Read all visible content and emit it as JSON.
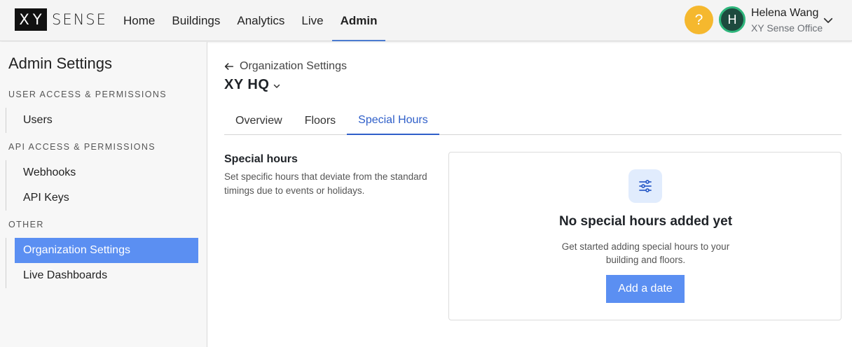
{
  "brand": {
    "mark": "XY",
    "word": "SENSE"
  },
  "nav": {
    "items": [
      {
        "label": "Home"
      },
      {
        "label": "Buildings"
      },
      {
        "label": "Analytics"
      },
      {
        "label": "Live"
      },
      {
        "label": "Admin"
      }
    ],
    "active": "Admin"
  },
  "header": {
    "help_label": "?",
    "avatar_initial": "H",
    "user_name": "Helena Wang",
    "user_org": "XY Sense Office"
  },
  "sidebar": {
    "title": "Admin Settings",
    "sections": [
      {
        "label": "USER ACCESS & PERMISSIONS",
        "items": [
          {
            "label": "Users"
          }
        ]
      },
      {
        "label": "API ACCESS & PERMISSIONS",
        "items": [
          {
            "label": "Webhooks"
          },
          {
            "label": "API Keys"
          }
        ]
      },
      {
        "label": "OTHER",
        "items": [
          {
            "label": "Organization Settings"
          },
          {
            "label": "Live Dashboards"
          }
        ]
      }
    ],
    "active_item": "Organization Settings"
  },
  "main": {
    "breadcrumb": "Organization Settings",
    "site_title": "XY HQ",
    "tabs": [
      {
        "label": "Overview"
      },
      {
        "label": "Floors"
      },
      {
        "label": "Special Hours"
      }
    ],
    "active_tab": "Special Hours",
    "section": {
      "heading": "Special hours",
      "description": "Set specific hours that deviate from the standard timings due to events or holidays."
    },
    "empty_state": {
      "title": "No special hours added yet",
      "text": "Get started adding special hours to your building and floors.",
      "button_label": "Add a date"
    }
  },
  "colors": {
    "accent": "#5b8ff2",
    "tab_active": "#2f5fc9",
    "help": "#f5b82e",
    "avatar_bg": "#1d4a3e",
    "avatar_ring": "#2fb67c"
  },
  "icons": {
    "back": "arrow-left-icon",
    "site_dropdown": "chevron-down-icon",
    "user_menu": "chevron-down-icon",
    "empty_state": "sliders-icon"
  }
}
